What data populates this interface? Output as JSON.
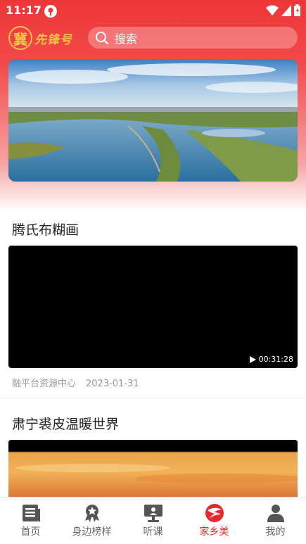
{
  "status_bar": {
    "time": "11:17"
  },
  "header": {
    "logo_seal": "冀",
    "logo_text": "先锋号",
    "search_placeholder": "搜索"
  },
  "feed": [
    {
      "title": "腾氏布糊画",
      "duration": "00:31:28",
      "source": "融平台资源中心",
      "date": "2023-01-31"
    },
    {
      "title": "肃宁裘皮温暖世界"
    }
  ],
  "tabbar": {
    "active": 3,
    "items": [
      {
        "label": "首页",
        "icon": "newspaper-icon"
      },
      {
        "label": "身边榜样",
        "icon": "ribbon-badge-icon"
      },
      {
        "label": "听课",
        "icon": "lecture-board-icon"
      },
      {
        "label": "家乡美",
        "icon": "hometown-logo-icon"
      },
      {
        "label": "我的",
        "icon": "person-icon"
      }
    ]
  },
  "colors": {
    "brand_red": "#e8282e",
    "logo_gold": "#f7c44a"
  }
}
